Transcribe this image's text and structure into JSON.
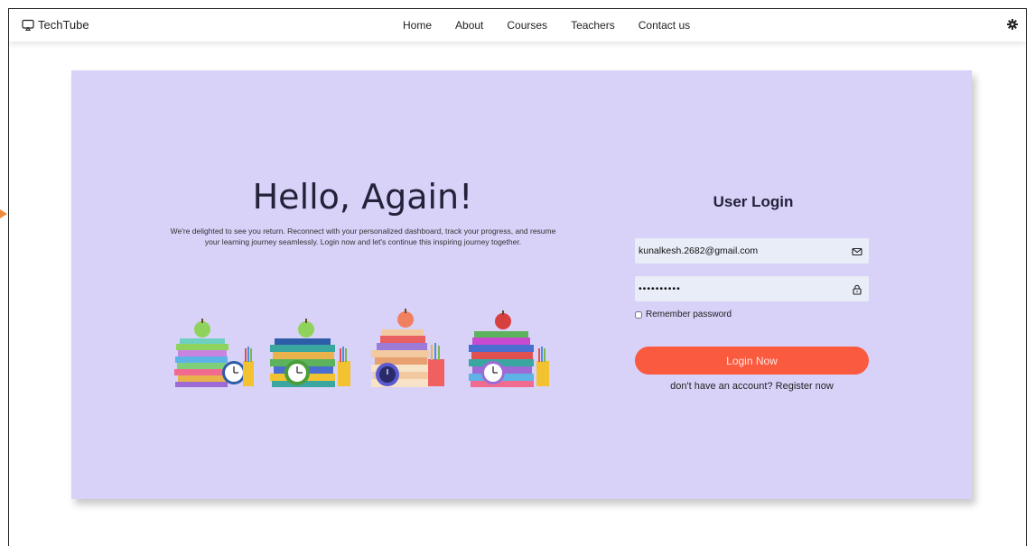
{
  "navbar": {
    "brand": "TechTube",
    "brand_icon": "monitor-icon",
    "links": [
      "Home",
      "About",
      "Courses",
      "Teachers",
      "Contact us"
    ],
    "settings_icon": "gear-icon"
  },
  "hero": {
    "title": "Hello, Again!",
    "intro_line1": "We're delighted to see you return. Reconnect with your personalized dashboard, track your progress, and resume",
    "intro_line2": "your learning journey seamlessly. Login now and let's continue this inspiring journey together."
  },
  "login": {
    "title": "User Login",
    "email_value": "kunalkesh.2682@gmail.com",
    "email_icon": "mail-icon",
    "password_value": "••••••••••",
    "password_icon": "lock-icon",
    "remember_label": "Remember password",
    "button_label": "Login Now",
    "register_prefix": "don't have an account?",
    "register_link": "Register now"
  },
  "colors": {
    "card_background": "#d8d1f8",
    "button": "#fa5a3e",
    "input_background": "#e8edf8"
  }
}
